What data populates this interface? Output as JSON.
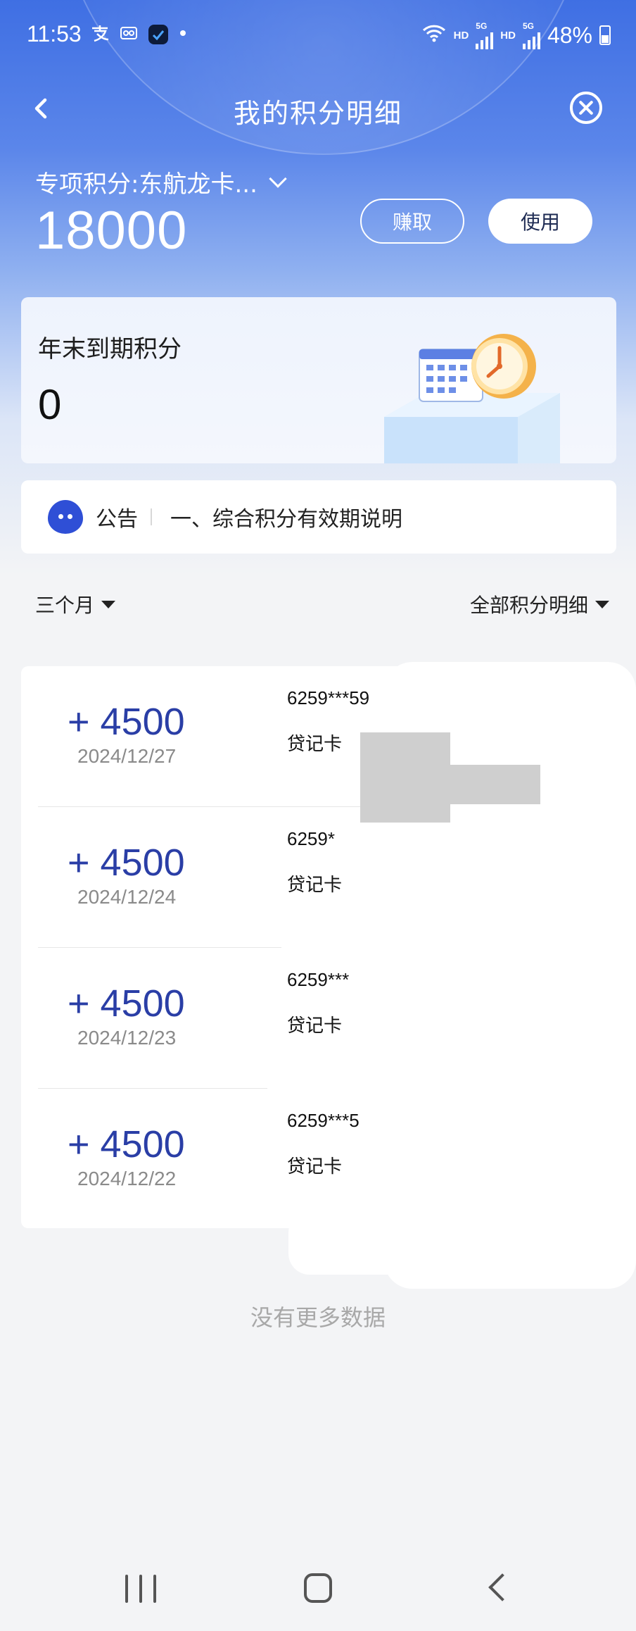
{
  "status_bar": {
    "time": "11:53",
    "left_icons": [
      "alipay-icon",
      "voicemail-icon",
      "app-icon",
      "dot-icon"
    ],
    "hd1": "HD",
    "hd2": "HD",
    "net1": "5G",
    "net2": "5G",
    "battery": "48%"
  },
  "header": {
    "title": "我的积分明细"
  },
  "points": {
    "type_label": "专项积分:东航龙卡...",
    "value": "18000",
    "earn_label": "赚取",
    "use_label": "使用"
  },
  "expiring": {
    "label": "年末到期积分",
    "value": "0"
  },
  "notice": {
    "tag": "公告",
    "text": "一、综合积分有效期说明"
  },
  "filters": {
    "period": "三个月",
    "category": "全部积分明细"
  },
  "records": [
    {
      "points": "+ 4500",
      "date": "2024/12/27",
      "card": "6259***59",
      "card_type": "贷记卡"
    },
    {
      "points": "+ 4500",
      "date": "2024/12/24",
      "card": "6259*",
      "card_type": "贷记卡"
    },
    {
      "points": "+ 4500",
      "date": "2024/12/23",
      "card": "6259***",
      "card_type": "贷记卡"
    },
    {
      "points": "+ 4500",
      "date": "2024/12/22",
      "card": "6259***5",
      "card_type": "贷记卡"
    }
  ],
  "footer": {
    "no_more": "没有更多数据"
  },
  "colors": {
    "brand_blue": "#3f6fe3",
    "points_blue": "#2a3ea6",
    "notice_icon": "#2f4fd6"
  }
}
